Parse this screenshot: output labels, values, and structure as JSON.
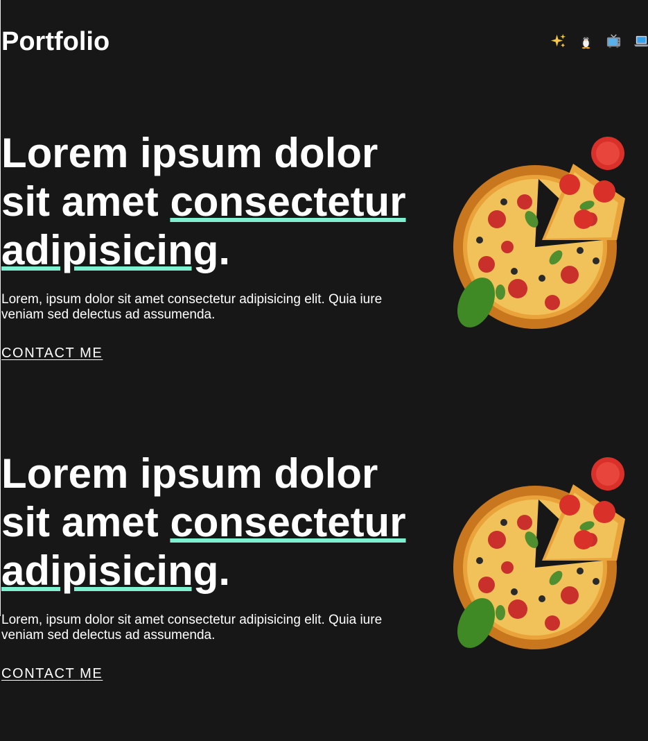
{
  "header": {
    "brand": "Portfolio",
    "nav_icons": [
      "sparkles-icon",
      "penguin-icon",
      "television-icon",
      "laptop-icon"
    ]
  },
  "sections": [
    {
      "headline_plain": "Lorem ipsum dolor sit amet",
      "headline_highlight_1": "consectetur",
      "headline_highlight_2": "adipisicing",
      "headline_end": ".",
      "description": "Lorem, ipsum dolor sit amet consectetur adipisicing elit. Quia iure veniam sed delectus ad assumenda.",
      "cta_label": "CONTACT ME",
      "image": "pizza-image"
    },
    {
      "headline_plain": "Lorem ipsum dolor sit amet",
      "headline_highlight_1": "consectetur",
      "headline_highlight_2": "adipisicing",
      "headline_end": ".",
      "description": "Lorem, ipsum dolor sit amet consectetur adipisicing elit. Quia iure veniam sed delectus ad assumenda.",
      "cta_label": "CONTACT ME",
      "image": "pizza-image"
    }
  ],
  "colors": {
    "background": "#171717",
    "text": "#ffffff",
    "accent": "#7ff0cf"
  }
}
